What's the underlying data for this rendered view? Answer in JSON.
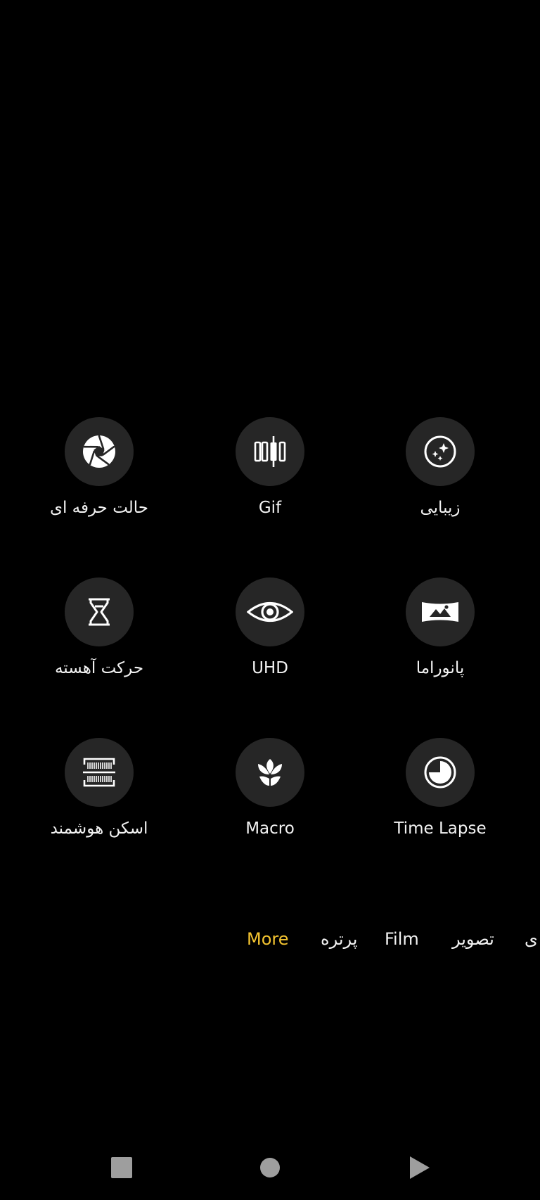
{
  "colors": {
    "background": "#000000",
    "tile_circle": "#262626",
    "icon": "#ffffff",
    "active_mode": "#f4c430",
    "nav_icon": "#9e9e9e"
  },
  "grid": {
    "rows": [
      [
        {
          "label": "حالت حرفه ای",
          "icon": "aperture-icon"
        },
        {
          "label": "Gif",
          "icon": "gif-film-icon"
        },
        {
          "label": "زیبایی",
          "icon": "beauty-sparkle-icon"
        }
      ],
      [
        {
          "label": "حرکت آهسته",
          "icon": "hourglass-icon"
        },
        {
          "label": "UHD",
          "icon": "eye-icon"
        },
        {
          "label": "پانوراما",
          "icon": "panorama-icon"
        }
      ],
      [
        {
          "label": "اسکن هوشمند",
          "icon": "scan-icon"
        },
        {
          "label": "Macro",
          "icon": "flower-icon"
        },
        {
          "label": "Time Lapse",
          "icon": "timer-icon"
        }
      ]
    ]
  },
  "mode_strip": {
    "items": [
      "More",
      "پرتره",
      "Film",
      "تصویر",
      "ی"
    ],
    "active": "More"
  },
  "nav": {
    "recents_icon": "square-icon",
    "home_icon": "circle-icon",
    "back_icon": "triangle-icon"
  }
}
